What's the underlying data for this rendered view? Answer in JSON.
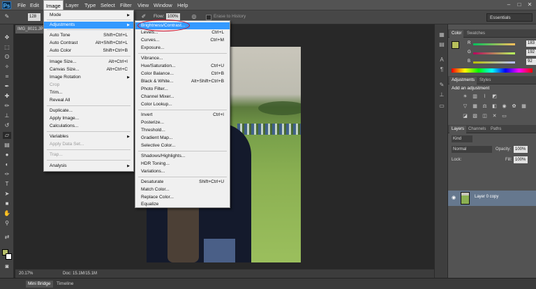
{
  "app": {
    "logo_text": "Ps"
  },
  "menubar": [
    "File",
    "Edit",
    "Image",
    "Layer",
    "Type",
    "Select",
    "Filter",
    "View",
    "Window",
    "Help"
  ],
  "window_controls": [
    "–",
    "□",
    "✕"
  ],
  "options_bar": {
    "flow_label": "Flow:",
    "flow_value": "100%",
    "erase_history": "Erase to History",
    "size_value": "128"
  },
  "workspace": "Essentials",
  "document": {
    "tab_label": "IMG_8021.JPG",
    "zoom": "20.17%",
    "doc_info": "Doc: 15.1M/15.1M"
  },
  "bottom_tabs": [
    "Mini Bridge",
    "Timeline"
  ],
  "image_menu": [
    {
      "label": "Mode",
      "shortcut": "",
      "submenu": true,
      "disabled": false
    },
    {
      "label": "Adjustments",
      "shortcut": "",
      "submenu": true,
      "disabled": false,
      "highlighted": true
    },
    {
      "label": "Auto Tone",
      "shortcut": "Shift+Ctrl+L",
      "submenu": false,
      "disabled": false
    },
    {
      "label": "Auto Contrast",
      "shortcut": "Alt+Shift+Ctrl+L",
      "submenu": false,
      "disabled": false
    },
    {
      "label": "Auto Color",
      "shortcut": "Shift+Ctrl+B",
      "submenu": false,
      "disabled": false
    },
    {
      "label": "Image Size...",
      "shortcut": "Alt+Ctrl+I",
      "submenu": false,
      "disabled": false
    },
    {
      "label": "Canvas Size...",
      "shortcut": "Alt+Ctrl+C",
      "submenu": false,
      "disabled": false
    },
    {
      "label": "Image Rotation",
      "shortcut": "",
      "submenu": true,
      "disabled": false
    },
    {
      "label": "Crop",
      "shortcut": "",
      "submenu": false,
      "disabled": true
    },
    {
      "label": "Trim...",
      "shortcut": "",
      "submenu": false,
      "disabled": false
    },
    {
      "label": "Reveal All",
      "shortcut": "",
      "submenu": false,
      "disabled": false
    },
    {
      "label": "Duplicate...",
      "shortcut": "",
      "submenu": false,
      "disabled": false
    },
    {
      "label": "Apply Image...",
      "shortcut": "",
      "submenu": false,
      "disabled": false
    },
    {
      "label": "Calculations...",
      "shortcut": "",
      "submenu": false,
      "disabled": false
    },
    {
      "label": "Variables",
      "shortcut": "",
      "submenu": true,
      "disabled": false
    },
    {
      "label": "Apply Data Set...",
      "shortcut": "",
      "submenu": false,
      "disabled": true
    },
    {
      "label": "Trap...",
      "shortcut": "",
      "submenu": false,
      "disabled": true
    },
    {
      "label": "Analysis",
      "shortcut": "",
      "submenu": true,
      "disabled": false
    }
  ],
  "adjustments_menu": [
    {
      "label": "Brightness/Contrast...",
      "shortcut": "",
      "highlighted": true
    },
    {
      "label": "Levels...",
      "shortcut": "Ctrl+L"
    },
    {
      "label": "Curves...",
      "shortcut": "Ctrl+M"
    },
    {
      "label": "Exposure...",
      "shortcut": ""
    },
    {
      "label": "Vibrance...",
      "shortcut": ""
    },
    {
      "label": "Hue/Saturation...",
      "shortcut": "Ctrl+U"
    },
    {
      "label": "Color Balance...",
      "shortcut": "Ctrl+B"
    },
    {
      "label": "Black & White...",
      "shortcut": "Alt+Shift+Ctrl+B"
    },
    {
      "label": "Photo Filter...",
      "shortcut": ""
    },
    {
      "label": "Channel Mixer...",
      "shortcut": ""
    },
    {
      "label": "Color Lookup...",
      "shortcut": ""
    },
    {
      "label": "Invert",
      "shortcut": "Ctrl+I"
    },
    {
      "label": "Posterize...",
      "shortcut": ""
    },
    {
      "label": "Threshold...",
      "shortcut": ""
    },
    {
      "label": "Gradient Map...",
      "shortcut": ""
    },
    {
      "label": "Selective Color...",
      "shortcut": ""
    },
    {
      "label": "Shadows/Highlights...",
      "shortcut": ""
    },
    {
      "label": "HDR Toning...",
      "shortcut": ""
    },
    {
      "label": "Variations...",
      "shortcut": ""
    },
    {
      "label": "Desaturate",
      "shortcut": "Shift+Ctrl+U"
    },
    {
      "label": "Match Color...",
      "shortcut": ""
    },
    {
      "label": "Replace Color...",
      "shortcut": ""
    },
    {
      "label": "Equalize",
      "shortcut": ""
    }
  ],
  "color_panel": {
    "tabs": [
      "Color",
      "Swatches"
    ],
    "r_label": "R",
    "r_value": "183",
    "g_label": "G",
    "g_value": "192",
    "b_label": "B",
    "b_value": "92",
    "swatch_color": "#b7c05c"
  },
  "adjustments_panel": {
    "tabs": [
      "Adjustments",
      "Styles"
    ],
    "heading": "Add an adjustment"
  },
  "layers_panel": {
    "tabs": [
      "Layers",
      "Channels",
      "Paths"
    ],
    "kind": "Kind",
    "blend_mode": "Normal",
    "opacity_label": "Opacity:",
    "opacity_value": "100%",
    "lock_label": "Lock:",
    "fill_label": "Fill:",
    "fill_value": "100%",
    "layer_name": "Layer 0 copy"
  },
  "colors": {
    "highlight": "#3399ff",
    "annotation": "#c8102e",
    "selected_layer": "#66788e"
  }
}
